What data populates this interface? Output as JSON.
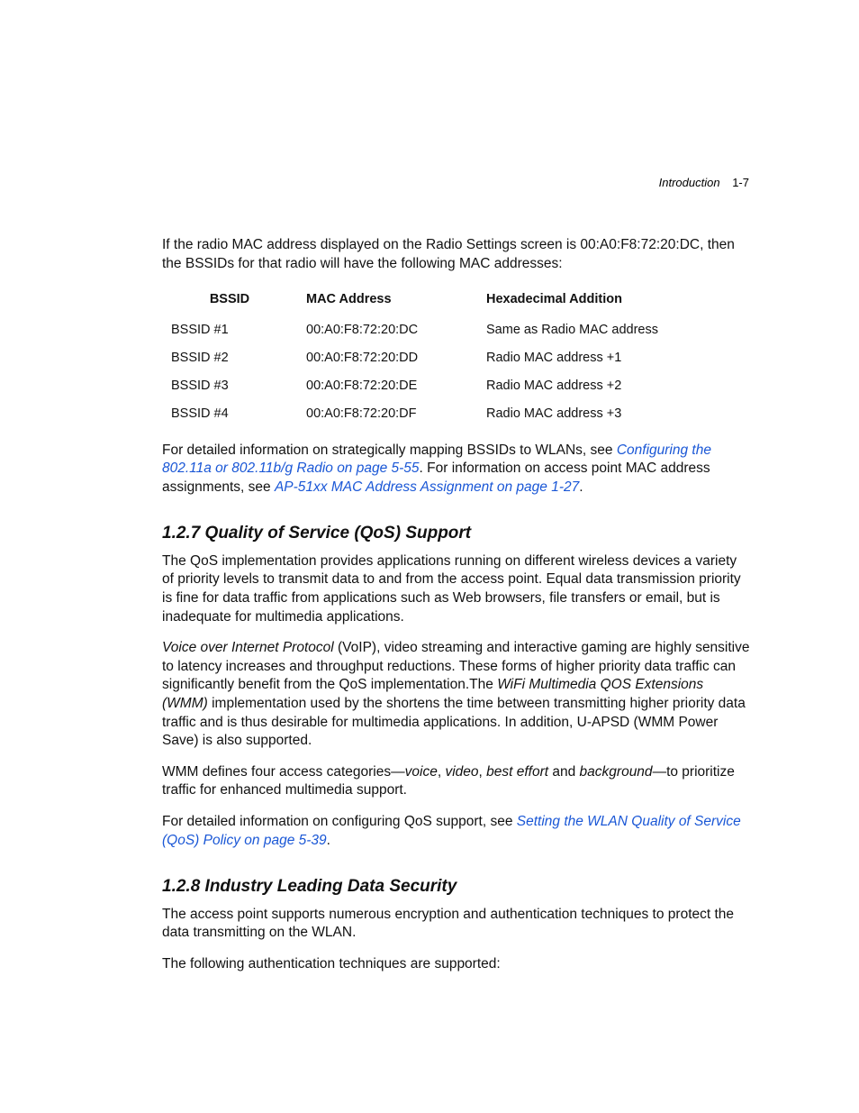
{
  "header": {
    "chapter": "Introduction",
    "page": "1-7"
  },
  "intro_para": "If the radio MAC address displayed on the Radio Settings screen is 00:A0:F8:72:20:DC, then the BSSIDs for that radio will have the following MAC addresses:",
  "table": {
    "headers": {
      "c1": "BSSID",
      "c2": "MAC Address",
      "c3": "Hexadecimal Addition"
    },
    "rows": [
      {
        "bssid": "BSSID #1",
        "mac": "00:A0:F8:72:20:DC",
        "hex": "Same as Radio MAC address"
      },
      {
        "bssid": "BSSID #2",
        "mac": "00:A0:F8:72:20:DD",
        "hex": "Radio MAC address +1"
      },
      {
        "bssid": "BSSID #3",
        "mac": "00:A0:F8:72:20:DE",
        "hex": "Radio MAC address +2"
      },
      {
        "bssid": "BSSID #4",
        "mac": "00:A0:F8:72:20:DF",
        "hex": "Radio MAC address +3"
      }
    ]
  },
  "para2_pre": "For detailed information on strategically mapping BSSIDs to WLANs, see ",
  "para2_link1": "Configuring the 802.11a or 802.11b/g Radio on page 5-55",
  "para2_mid": ". For information on access point MAC address assignments, see ",
  "para2_link2": "AP-51xx MAC Address Assignment on page 1-27",
  "para2_post": ".",
  "sec127": {
    "title": "1.2.7 Quality of Service (QoS) Support",
    "p1": "The QoS implementation provides applications running on different wireless devices a variety of priority levels to transmit data to and from the access point. Equal data transmission priority is fine for data traffic from applications such as Web browsers, file transfers or email, but is inadequate for multimedia applications.",
    "p2_em1": "Voice over Internet Protocol",
    "p2_a": " (VoIP), video streaming and interactive gaming are highly sensitive to latency increases and throughput reductions. These forms of higher priority data traffic can significantly benefit from the  QoS implementation.The ",
    "p2_em2": "WiFi Multimedia QOS Extensions (WMM)",
    "p2_b": " implementation used by the  shortens the time between transmitting higher priority data traffic and is thus desirable for multimedia applications. In addition, U-APSD (WMM Power Save) is also supported.",
    "p3_a": "WMM defines four access categories—",
    "p3_em1": "voice",
    "p3_s1": ", ",
    "p3_em2": "video",
    "p3_s2": ", ",
    "p3_em3": "best effort",
    "p3_s3": " and ",
    "p3_em4": "background",
    "p3_b": "—to prioritize traffic for enhanced multimedia support.",
    "p4_a": "For detailed information on configuring QoS support, see ",
    "p4_link": "Setting the WLAN Quality of Service (QoS) Policy on page 5-39",
    "p4_b": "."
  },
  "sec128": {
    "title": "1.2.8 Industry Leading Data Security",
    "p1": "The access point supports numerous encryption and authentication techniques to protect the data transmitting on the WLAN.",
    "p2": "The following authentication techniques are supported:"
  }
}
